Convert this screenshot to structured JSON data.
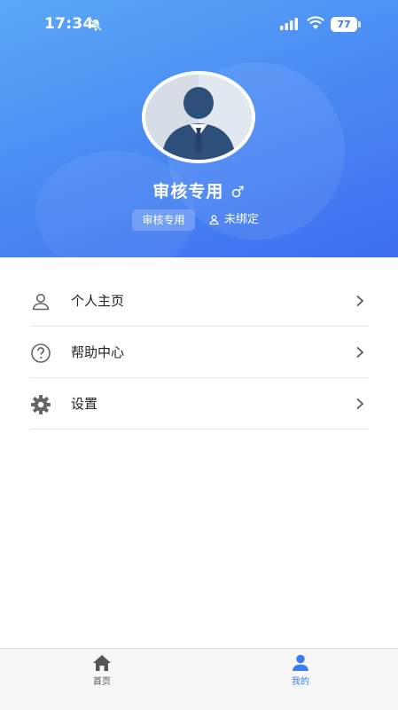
{
  "status_bar": {
    "time": "17:34",
    "battery": "77"
  },
  "profile": {
    "name": "审核专用",
    "gender_symbol": "♂",
    "role_badge": "审核专用",
    "bind_status": "未绑定"
  },
  "menu": {
    "items": [
      {
        "label": "个人主页",
        "icon": "person-icon"
      },
      {
        "label": "帮助中心",
        "icon": "help-icon"
      },
      {
        "label": "设置",
        "icon": "gear-icon"
      }
    ]
  },
  "tabbar": {
    "tabs": [
      {
        "label": "首页",
        "icon": "home-icon",
        "active": false
      },
      {
        "label": "我的",
        "icon": "user-icon",
        "active": true
      }
    ]
  },
  "colors": {
    "header_start": "#5aa8f6",
    "header_end": "#3d6ef0",
    "accent": "#3b7cf2"
  }
}
